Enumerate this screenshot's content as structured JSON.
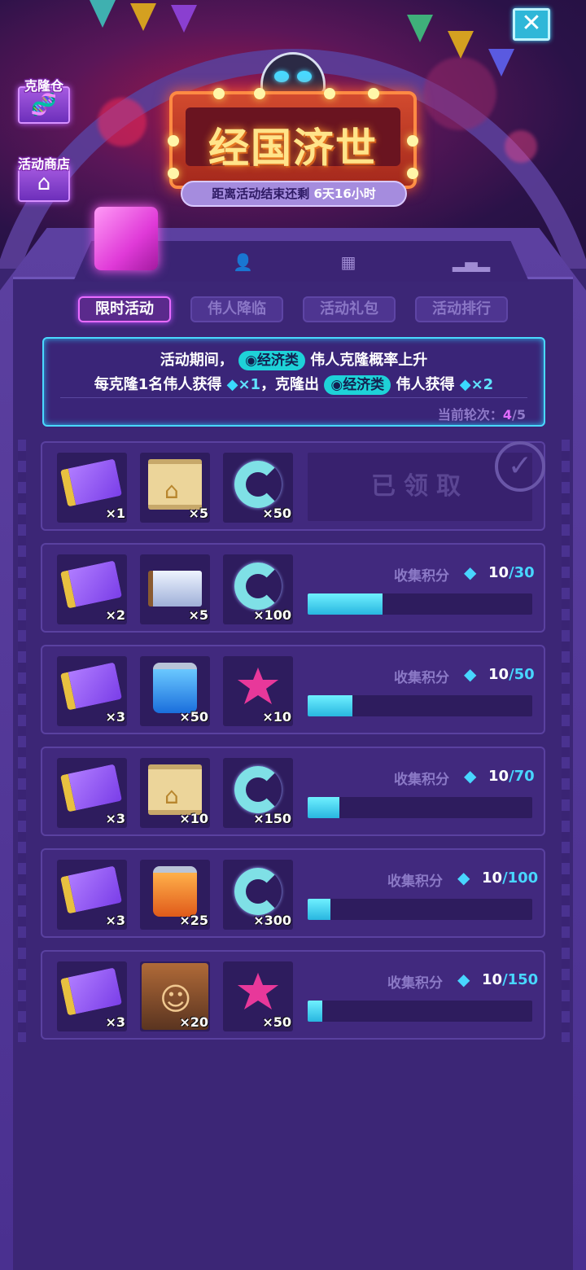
{
  "header": {
    "sign_title": "经国济世",
    "countdown_prefix": "距离活动结束还剩",
    "countdown_value": "6天16小时",
    "close_icon": "close-icon"
  },
  "side_buttons": [
    {
      "label": "克隆仓",
      "icon": "dna-icon"
    },
    {
      "label": "活动商店",
      "icon": "shop-icon"
    }
  ],
  "icon_tabs": [
    "cube-icon",
    "person-icon",
    "gift-icon",
    "ranking-icon"
  ],
  "tabs": [
    {
      "label": "限时活动",
      "active": true
    },
    {
      "label": "伟人降临",
      "active": false
    },
    {
      "label": "活动礼包",
      "active": false
    },
    {
      "label": "活动排行",
      "active": false
    }
  ],
  "info": {
    "line1_prefix": "活动期间，",
    "line1_pill": "经济类",
    "line1_suffix": "伟人克隆概率上升",
    "line2_a": "每克隆1名伟人获得",
    "line2_x1": "×1",
    "line2_b": "，克隆出",
    "line2_pill": "经济类",
    "line2_c": "伟人获得",
    "line2_x2": "×2",
    "round_label": "当前轮次：",
    "round_current": "4",
    "round_total": "/5"
  },
  "rewards": [
    {
      "items": [
        {
          "icon": "ticket",
          "qty": "×1"
        },
        {
          "icon": "scroll",
          "qty": "×5"
        },
        {
          "icon": "c-item",
          "qty": "×50"
        }
      ],
      "claimed": true,
      "claimed_label": "已领取"
    },
    {
      "items": [
        {
          "icon": "ticket",
          "qty": "×2"
        },
        {
          "icon": "bed",
          "qty": "×5"
        },
        {
          "icon": "c-item",
          "qty": "×100"
        }
      ],
      "score_label": "收集积分",
      "score_current": "10",
      "score_max": "/30",
      "progress": 0.3333
    },
    {
      "items": [
        {
          "icon": "ticket",
          "qty": "×3"
        },
        {
          "icon": "jar-blue",
          "qty": "×50"
        },
        {
          "icon": "star-pink",
          "qty": "×10"
        }
      ],
      "score_label": "收集积分",
      "score_current": "10",
      "score_max": "/50",
      "progress": 0.2
    },
    {
      "items": [
        {
          "icon": "ticket",
          "qty": "×3"
        },
        {
          "icon": "scroll",
          "qty": "×10"
        },
        {
          "icon": "c-item",
          "qty": "×150"
        }
      ],
      "score_label": "收集积分",
      "score_current": "10",
      "score_max": "/70",
      "progress": 0.1429
    },
    {
      "items": [
        {
          "icon": "ticket",
          "qty": "×3"
        },
        {
          "icon": "jar-orange",
          "qty": "×25"
        },
        {
          "icon": "c-item",
          "qty": "×300"
        }
      ],
      "score_label": "收集积分",
      "score_current": "10",
      "score_max": "/100",
      "progress": 0.1
    },
    {
      "items": [
        {
          "icon": "ticket",
          "qty": "×3"
        },
        {
          "icon": "hero",
          "qty": "×20"
        },
        {
          "icon": "star-pink",
          "qty": "×50"
        }
      ],
      "score_label": "收集积分",
      "score_current": "10",
      "score_max": "/150",
      "progress": 0.0667
    }
  ],
  "colors": {
    "accent_cyan": "#48d6ff",
    "active_pink": "#e86cff",
    "sign_gold": "#ffe48a"
  }
}
